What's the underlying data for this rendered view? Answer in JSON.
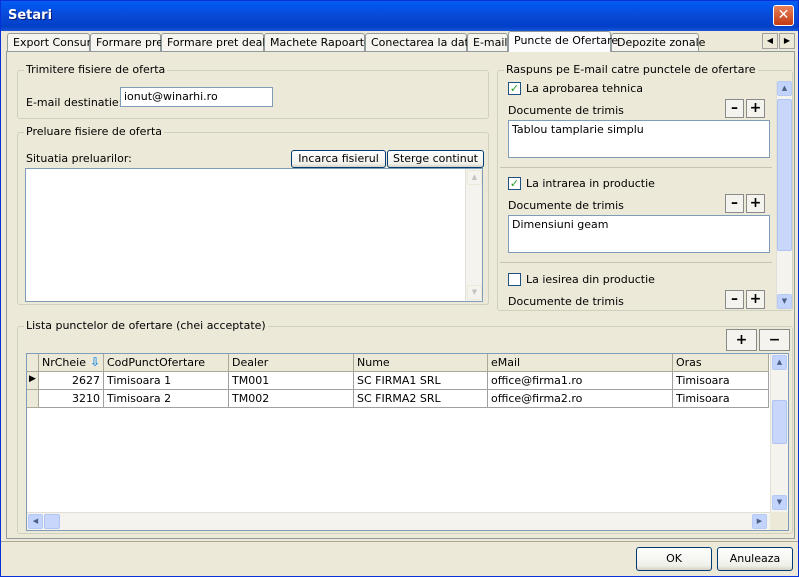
{
  "window": {
    "title": "Setari"
  },
  "tabs": [
    {
      "label": "Export Consum",
      "active": false
    },
    {
      "label": "Formare pret",
      "active": false
    },
    {
      "label": "Formare pret dealer",
      "active": false
    },
    {
      "label": "Machete Rapoarte",
      "active": false
    },
    {
      "label": "Conectarea la date",
      "active": false
    },
    {
      "label": "E-mail",
      "active": false
    },
    {
      "label": "Puncte de Ofertare",
      "active": true
    },
    {
      "label": "Depozite zonale",
      "active": false
    }
  ],
  "trimitere": {
    "title": "Trimitere fisiere de oferta",
    "email_label": "E-mail destinatie:",
    "email_value": "ionut@winarhi.ro"
  },
  "preluare": {
    "title": "Preluare fisiere de oferta",
    "status_label": "Situatia preluarilor:",
    "load_button": "Incarca fisierul",
    "clear_button": "Sterge continut"
  },
  "raspuns": {
    "title": "Raspuns pe E-mail catre punctele de ofertare",
    "sections": [
      {
        "label": "La aprobarea tehnica",
        "checked": true,
        "docs_label": "Documente de trimis",
        "docs": "Tablou tamplarie simplu"
      },
      {
        "label": "La intrarea in productie",
        "checked": true,
        "docs_label": "Documente de trimis",
        "docs": "Dimensiuni geam"
      },
      {
        "label": "La iesirea din productie",
        "checked": false,
        "docs_label": "Documente de trimis",
        "docs": ""
      }
    ],
    "minus": "–",
    "plus": "+"
  },
  "lista": {
    "title": "Lista punctelor de ofertare (chei acceptate)",
    "add": "+",
    "remove": "−",
    "columns": [
      "NrCheie",
      "CodPunctOfertare",
      "Dealer",
      "Nume",
      "eMail",
      "Oras"
    ],
    "rows": [
      [
        "2627",
        "Timisoara 1",
        "TM001",
        "SC FIRMA1 SRL",
        "office@firma1.ro",
        "Timisoara"
      ],
      [
        "3210",
        "Timisoara 2",
        "TM002",
        "SC FIRMA2 SRL",
        "office@firma2.ro",
        "Timisoara"
      ]
    ]
  },
  "footer": {
    "ok": "OK",
    "cancel": "Anuleaza"
  },
  "icons": {
    "close": "close-icon",
    "sort": "sort-arrow-icon",
    "row_pointer": "row-pointer-icon",
    "check": "checkmark-icon"
  },
  "colors": {
    "titlebar": "#0a48d6",
    "window_bg": "#ece9d8",
    "accent": "#0831d9"
  }
}
